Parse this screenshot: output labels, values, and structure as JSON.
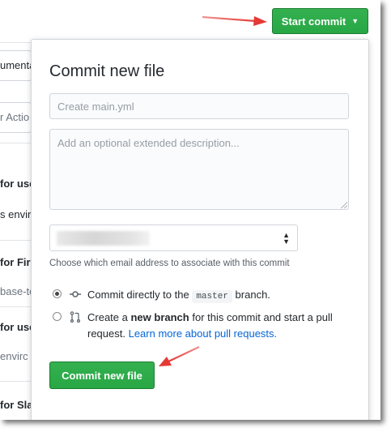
{
  "background": {
    "fragments": [
      {
        "text": "umentati",
        "style": "normal"
      },
      {
        "text": "r Actio",
        "style": "muted"
      },
      {
        "text": "for use",
        "style": "bold"
      },
      {
        "text": "s enviro",
        "style": "normal"
      },
      {
        "text": "for Fir",
        "style": "bold"
      },
      {
        "text": "base-to",
        "style": "normal"
      },
      {
        "text": "for use",
        "style": "bold"
      },
      {
        "text": "envirc",
        "style": "normal"
      },
      {
        "text": "for Sla",
        "style": "bold"
      }
    ]
  },
  "header": {
    "start_commit_label": "Start commit",
    "caret_icon": "triangle-down-icon"
  },
  "commit_form": {
    "title": "Commit new file",
    "summary_placeholder": "Create main.yml",
    "description_placeholder": "Add an optional extended description...",
    "email_select": {
      "selected_value": "",
      "note": "Choose which email address to associate with this commit"
    },
    "options": [
      {
        "id": "direct",
        "checked": true,
        "icon": "git-commit-icon",
        "prefix": "Commit directly to the ",
        "branch": "master",
        "suffix": " branch."
      },
      {
        "id": "new-branch",
        "checked": false,
        "icon": "git-pull-request-icon",
        "prefix": "Create a ",
        "bold": "new branch",
        "middle": " for this commit and start a pull request. ",
        "link": "Learn more about pull requests."
      }
    ],
    "submit_label": "Commit new file"
  },
  "colors": {
    "primary_green": "#28a745",
    "link_blue": "#0366d6",
    "annotation_arrow": "#e53935"
  }
}
